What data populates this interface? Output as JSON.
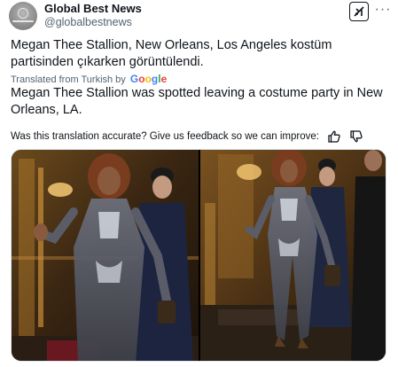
{
  "post": {
    "author_name": "Global Best News",
    "author_handle": "@globalbestnews",
    "text": "Megan Thee Stallion, New Orleans, Los Angeles kostüm partisinden çıkarken görüntülendi.",
    "translated_by_label": "Translated from Turkish by",
    "translation_provider": {
      "letters": [
        "G",
        "o",
        "o",
        "g",
        "l",
        "e"
      ],
      "colors": [
        "#4285f4",
        "#ea4335",
        "#fbbc05",
        "#4285f4",
        "#34a853",
        "#ea4335"
      ]
    },
    "translated_text": "Megan Thee Stallion was spotted leaving a costume party in New Orleans, LA.",
    "feedback_prompt": "Was this translation accurate? Give us feedback so we can improve:"
  },
  "icons": {
    "avatar": "globe-logo-icon",
    "grok": "grok-icon",
    "more": "more-icon",
    "thumbs_up": "thumbs-up-icon",
    "thumbs_down": "thumbs-down-icon"
  },
  "media": {
    "photos": [
      {
        "description_name": "photo-1"
      },
      {
        "description_name": "photo-2"
      }
    ]
  },
  "colors": {
    "text_primary": "#0f1419",
    "text_secondary": "#536471"
  }
}
